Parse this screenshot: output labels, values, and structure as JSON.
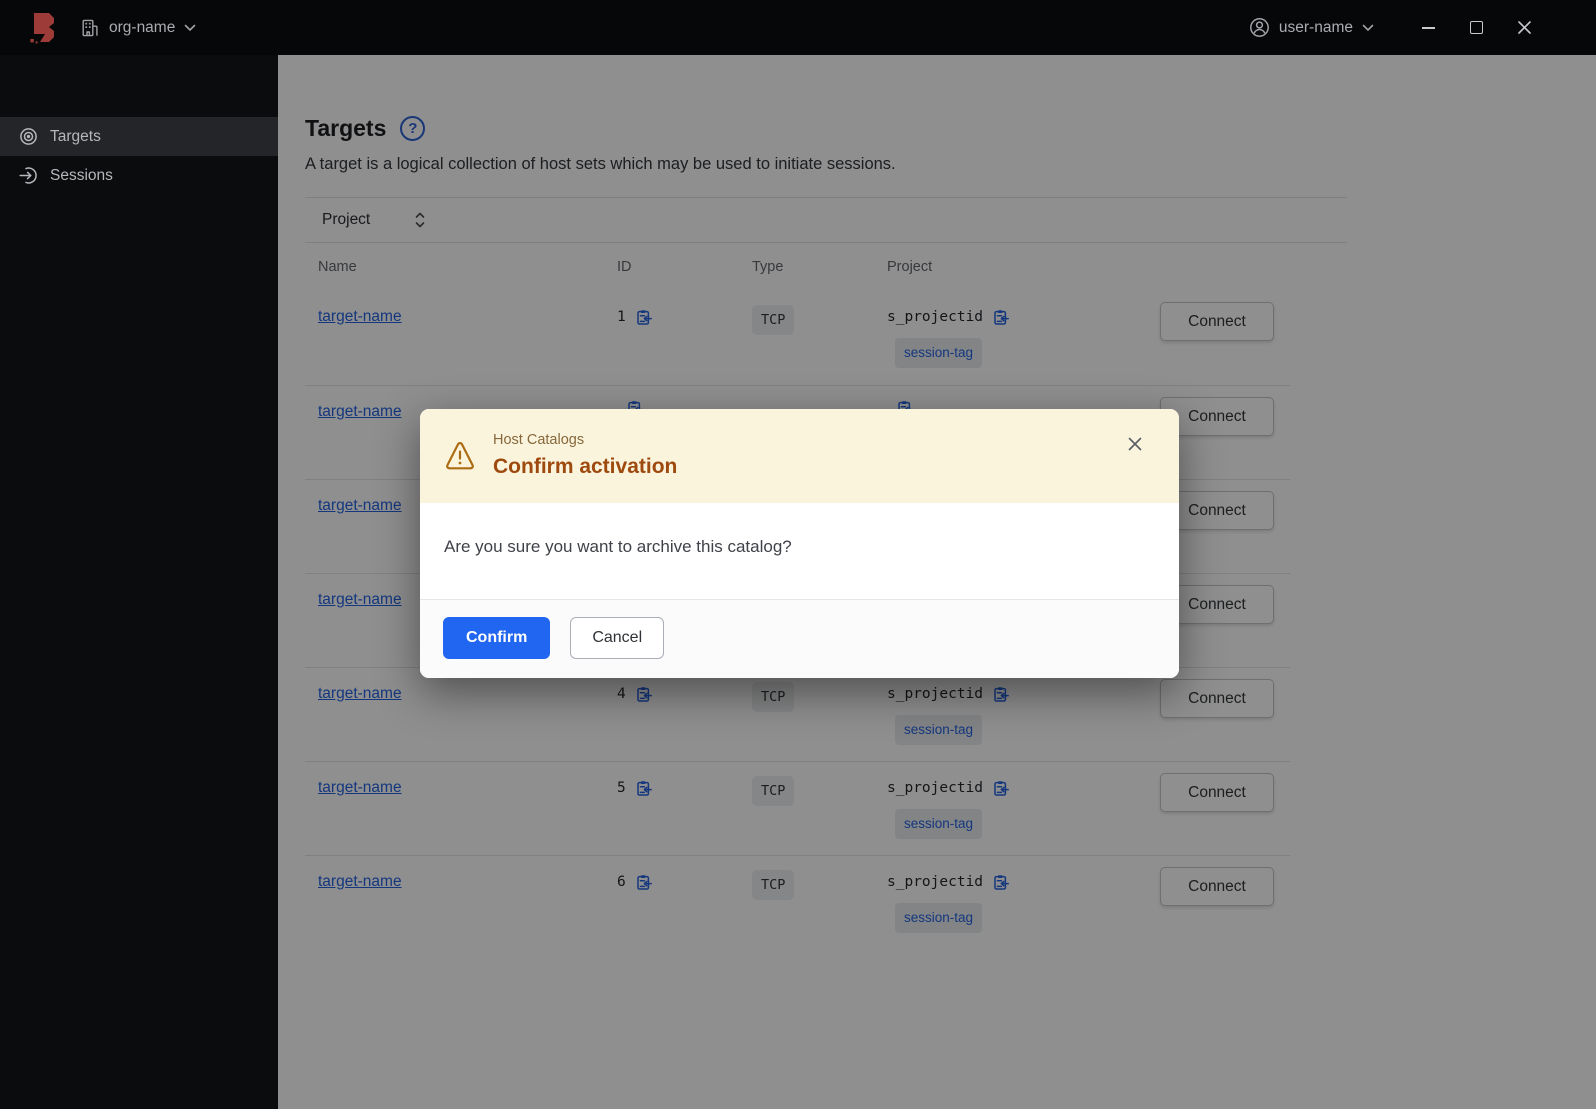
{
  "titlebar": {
    "org_name": "org-name",
    "user_name": "user-name"
  },
  "sidebar": {
    "items": [
      {
        "label": "Targets",
        "active": true
      },
      {
        "label": "Sessions",
        "active": false
      }
    ]
  },
  "page": {
    "title": "Targets",
    "help_glyph": "?",
    "description": "A target is a logical collection of host sets which may be used to initiate sessions.",
    "filter_label": "Project"
  },
  "table": {
    "columns": [
      "Name",
      "ID",
      "Type",
      "Project"
    ],
    "connect_label": "Connect",
    "rows": [
      {
        "name": "target-name",
        "id": "1",
        "type": "TCP",
        "project": "s_projectid",
        "tag": "session-tag"
      },
      {
        "name": "target-name",
        "id": "",
        "type": "",
        "project": "",
        "tag": ""
      },
      {
        "name": "target-name",
        "id": "",
        "type": "",
        "project": "",
        "tag": ""
      },
      {
        "name": "target-name",
        "id": "",
        "type": "",
        "project": "",
        "tag": ""
      },
      {
        "name": "target-name",
        "id": "4",
        "type": "TCP",
        "project": "s_projectid",
        "tag": "session-tag"
      },
      {
        "name": "target-name",
        "id": "5",
        "type": "TCP",
        "project": "s_projectid",
        "tag": "session-tag"
      },
      {
        "name": "target-name",
        "id": "6",
        "type": "TCP",
        "project": "s_projectid",
        "tag": "session-tag"
      }
    ]
  },
  "dialog": {
    "context": "Host Catalogs",
    "title": "Confirm activation",
    "message": "Are you sure you want to archive this catalog?",
    "confirm_label": "Confirm",
    "cancel_label": "Cancel"
  },
  "colors": {
    "accent_blue": "#2166f0",
    "link_blue": "#2563e0",
    "warning_surface": "#fbf4dd",
    "warning_title": "#9e4a0e",
    "warning_icon": "#ad6c13",
    "logo_red": "#9c3b38",
    "overlay": "rgba(0,0,0,0.44)"
  }
}
